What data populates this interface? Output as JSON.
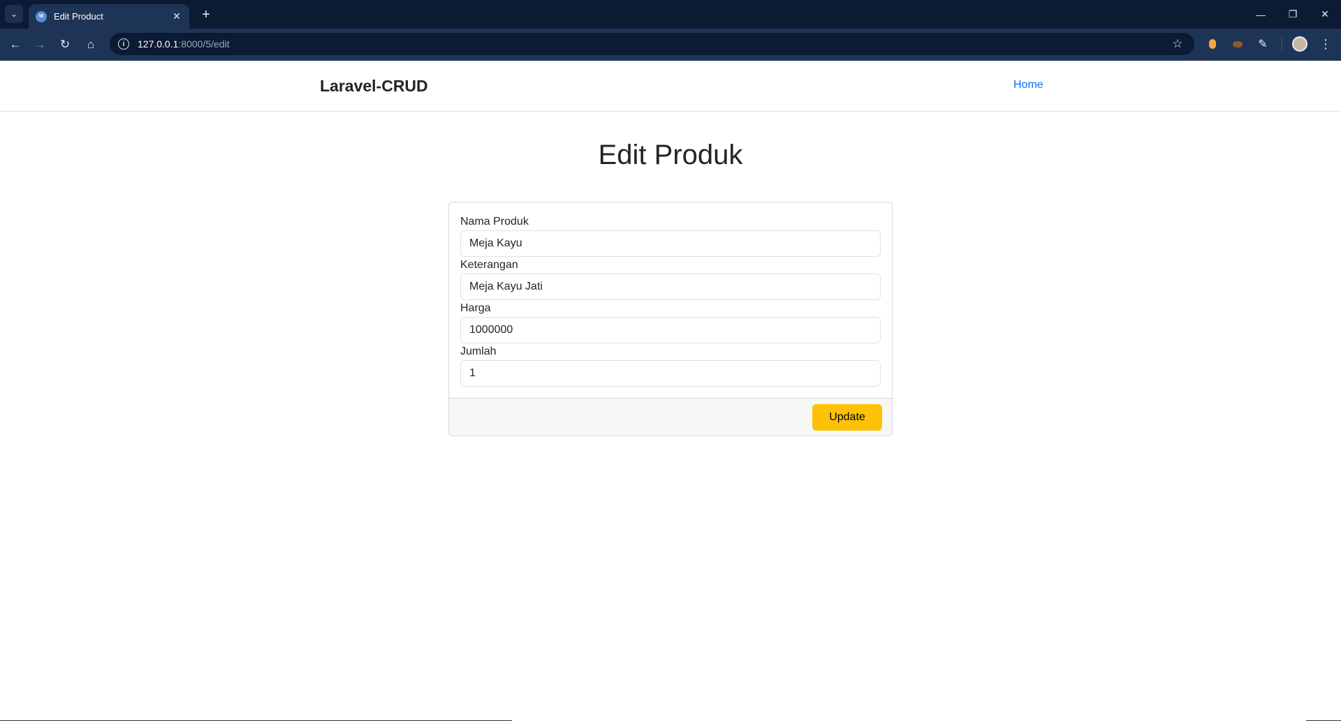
{
  "browser": {
    "tab_title": "Edit Product",
    "url_host": "127.0.0.1",
    "url_path": ":8000/5/edit"
  },
  "navbar": {
    "brand": "Laravel-CRUD",
    "home_link": "Home"
  },
  "page": {
    "title": "Edit Produk"
  },
  "form": {
    "fields": [
      {
        "label": "Nama Produk",
        "value": "Meja Kayu"
      },
      {
        "label": "Keterangan",
        "value": "Meja Kayu Jati"
      },
      {
        "label": "Harga",
        "value": "1000000"
      },
      {
        "label": "Jumlah",
        "value": "1"
      }
    ],
    "submit_label": "Update"
  },
  "colors": {
    "accent_button": "#ffc107",
    "link": "#0d6efd",
    "browser_frame": "#0c1a33"
  }
}
